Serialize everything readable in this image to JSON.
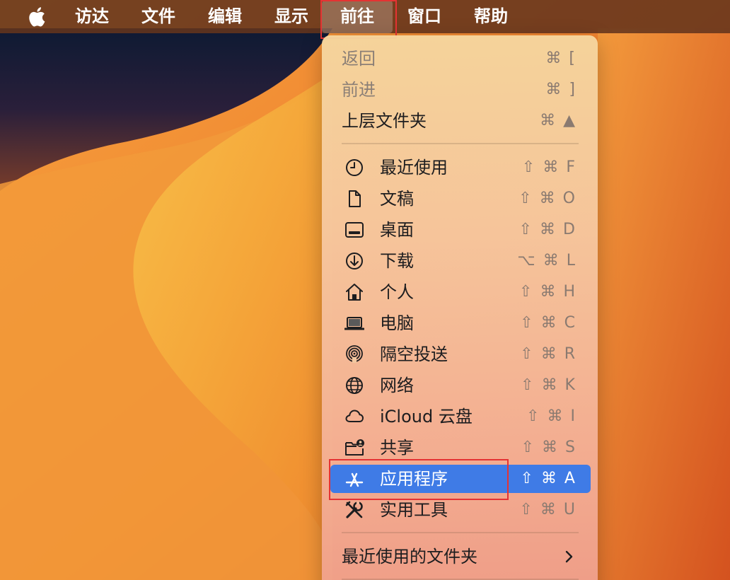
{
  "menubar": {
    "apple_icon": "apple-logo-icon",
    "items": [
      {
        "label": "访达"
      },
      {
        "label": "文件"
      },
      {
        "label": "编辑"
      },
      {
        "label": "显示"
      },
      {
        "label": "前往",
        "active": true
      },
      {
        "label": "窗口"
      },
      {
        "label": "帮助"
      }
    ]
  },
  "go_menu": {
    "items": [
      {
        "label": "返回",
        "shortcut": "⌘ [",
        "disabled": true
      },
      {
        "label": "前进",
        "shortcut": "⌘ ]",
        "disabled": true
      },
      {
        "label": "上层文件夹",
        "shortcut": "⌘ ▲"
      },
      {
        "label": "最近使用",
        "shortcut": "⇧ ⌘ F",
        "icon": "clock-icon"
      },
      {
        "label": "文稿",
        "shortcut": "⇧ ⌘ O",
        "icon": "document-icon"
      },
      {
        "label": "桌面",
        "shortcut": "⇧ ⌘ D",
        "icon": "desktop-icon"
      },
      {
        "label": "下载",
        "shortcut": "⌥ ⌘ L",
        "icon": "download-icon"
      },
      {
        "label": "个人",
        "shortcut": "⇧ ⌘ H",
        "icon": "home-icon"
      },
      {
        "label": "电脑",
        "shortcut": "⇧ ⌘ C",
        "icon": "laptop-icon"
      },
      {
        "label": "隔空投送",
        "shortcut": "⇧ ⌘ R",
        "icon": "airdrop-icon"
      },
      {
        "label": "网络",
        "shortcut": "⇧ ⌘ K",
        "icon": "globe-icon"
      },
      {
        "label": "iCloud 云盘",
        "shortcut": "⇧ ⌘ I",
        "icon": "cloud-icon"
      },
      {
        "label": "共享",
        "shortcut": "⇧ ⌘ S",
        "icon": "shared-folder-icon"
      },
      {
        "label": "应用程序",
        "shortcut": "⇧ ⌘ A",
        "icon": "applications-icon",
        "selected": true
      },
      {
        "label": "实用工具",
        "shortcut": "⇧ ⌘ U",
        "icon": "utilities-icon"
      },
      {
        "label": "最近使用的文件夹",
        "submenu_icon": "chevron-right-icon"
      }
    ]
  },
  "colors": {
    "selection": "#3f7be6",
    "highlight_box": "#e53333",
    "menubar": "#64341c"
  }
}
